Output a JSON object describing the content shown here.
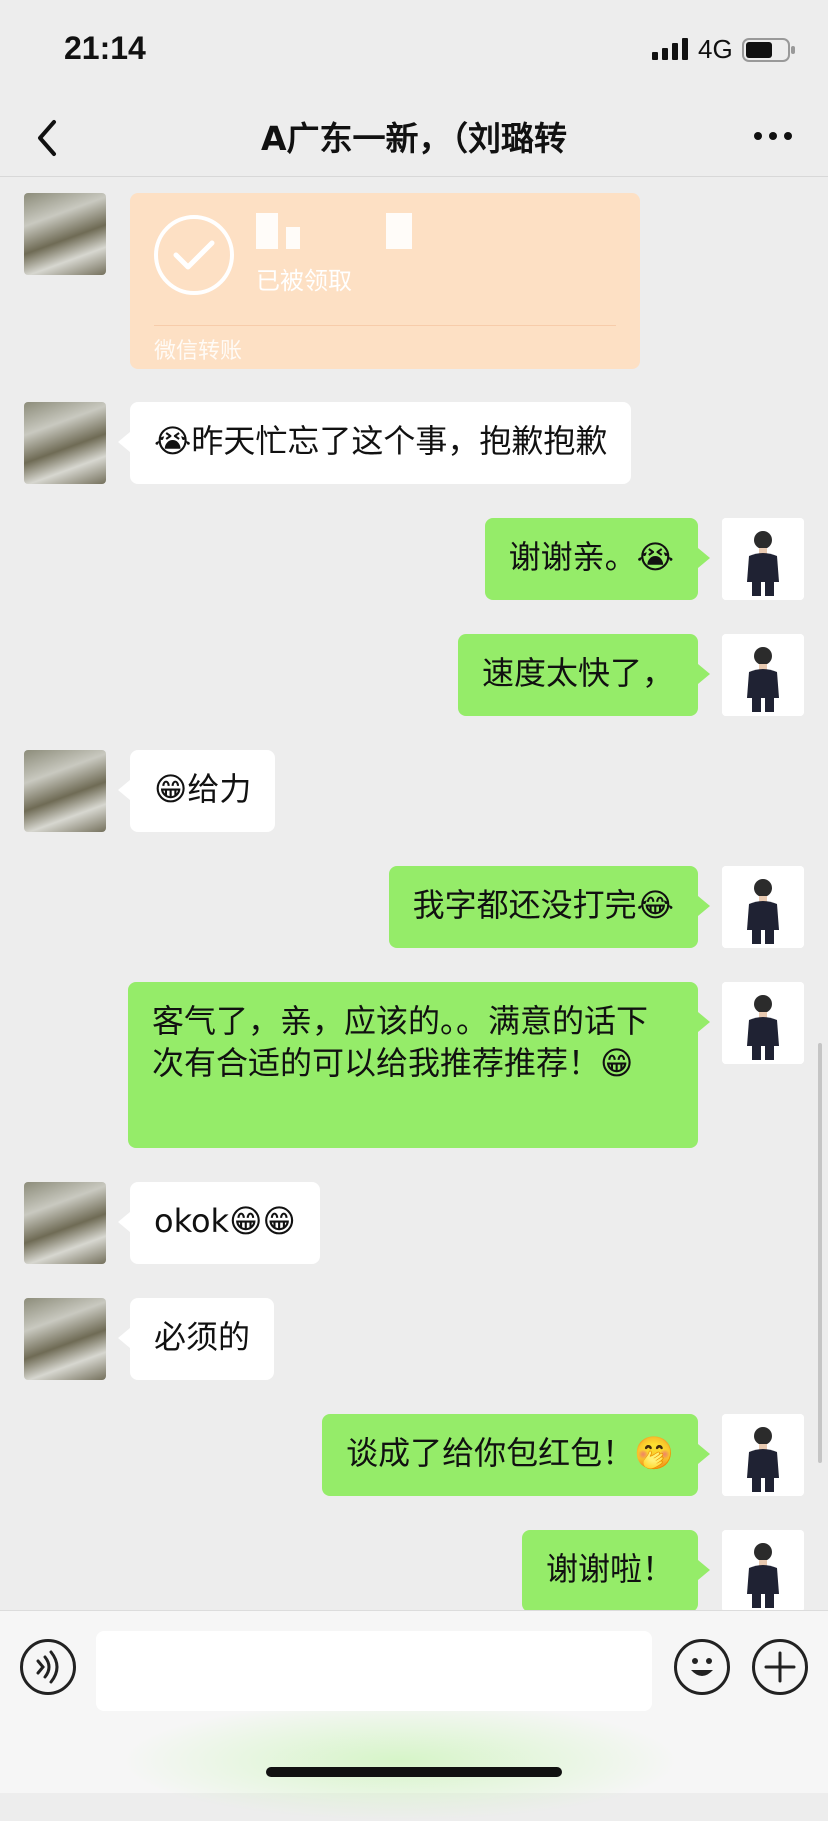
{
  "status": {
    "time": "21:14",
    "network": "4G"
  },
  "nav": {
    "title": "A广东一新，（刘璐转"
  },
  "transfer": {
    "status": "已被领取",
    "label": "微信转账"
  },
  "messages": [
    {
      "side": "in",
      "text": "😭昨天忙忘了这个事，抱歉抱歉"
    },
    {
      "side": "out",
      "text": "谢谢亲。😭"
    },
    {
      "side": "out",
      "text": "速度太快了，"
    },
    {
      "side": "in",
      "text": "😁给力"
    },
    {
      "side": "out",
      "text": "我字都还没打完😂"
    },
    {
      "side": "out",
      "text": "客气了，亲，应该的。。满意的话下次有合适的可以给我推荐推荐！😁"
    },
    {
      "side": "in",
      "text": "okok😁😁"
    },
    {
      "side": "in",
      "text": "必须的"
    },
    {
      "side": "out",
      "text": "谈成了给你包红包！🤭"
    },
    {
      "side": "out",
      "text": "谢谢啦！"
    }
  ],
  "colors": {
    "self_bubble": "#95ec69",
    "other_bubble": "#ffffff",
    "transfer_bubble": "#fde0c4",
    "background": "#ededed"
  }
}
